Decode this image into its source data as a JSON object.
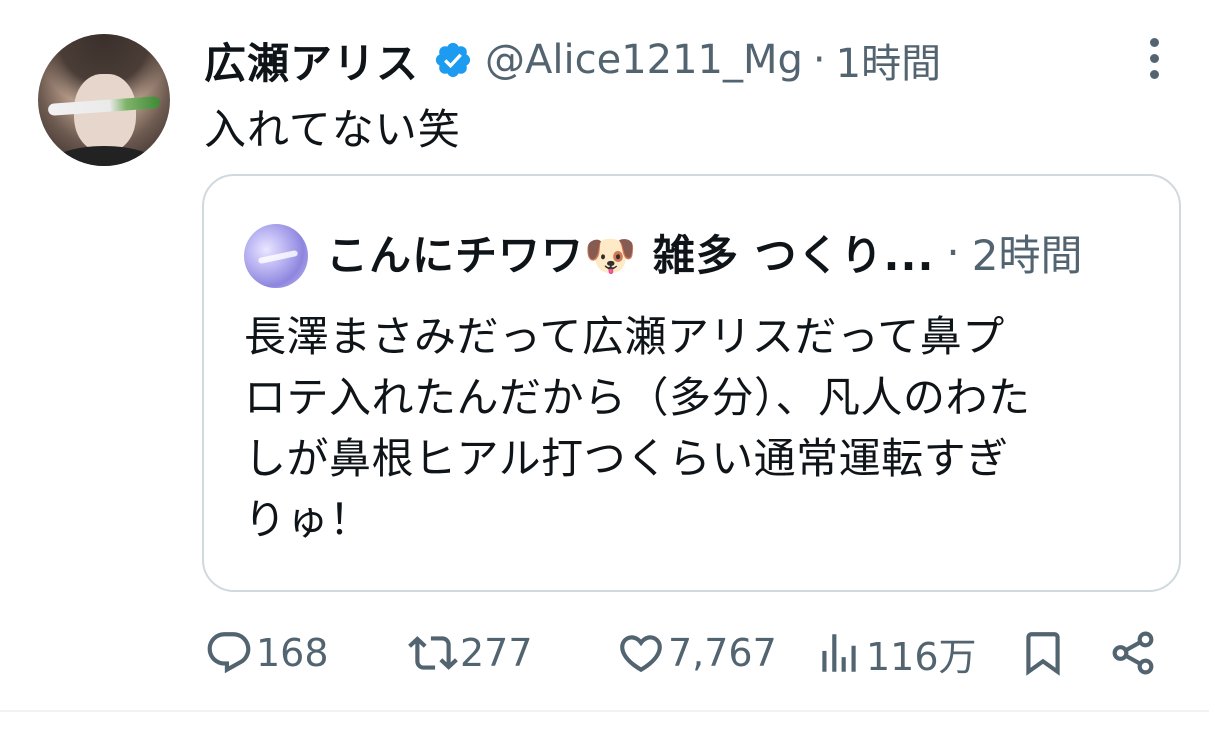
{
  "tweet": {
    "name": "広瀬アリス",
    "handle": "@Alice1211_Mg",
    "separator": "·",
    "time": "1時間",
    "text": "入れてない笑"
  },
  "quoted": {
    "name": "こんにチワワ🐶 雑多 つくり...",
    "separator": "·",
    "time": "2時間",
    "lines": [
      "長澤まさみだって広瀬アリスだって鼻プ",
      "ロテ入れたんだから（多分）、凡人のわた",
      "しが鼻根ヒアル打つくらい通常運転すぎ",
      "りゅ！"
    ]
  },
  "actions": {
    "replies": "168",
    "retweets": "277",
    "likes": "7,767",
    "views": "116万"
  },
  "colors": {
    "verified": "#1d9bf0",
    "muted": "#536471",
    "text": "#0f1419",
    "border": "#cfd9de"
  },
  "icons": [
    "verified-badge-icon",
    "more-dots-icon",
    "reply-icon",
    "retweet-icon",
    "like-icon",
    "views-icon",
    "bookmark-icon",
    "share-icon"
  ]
}
